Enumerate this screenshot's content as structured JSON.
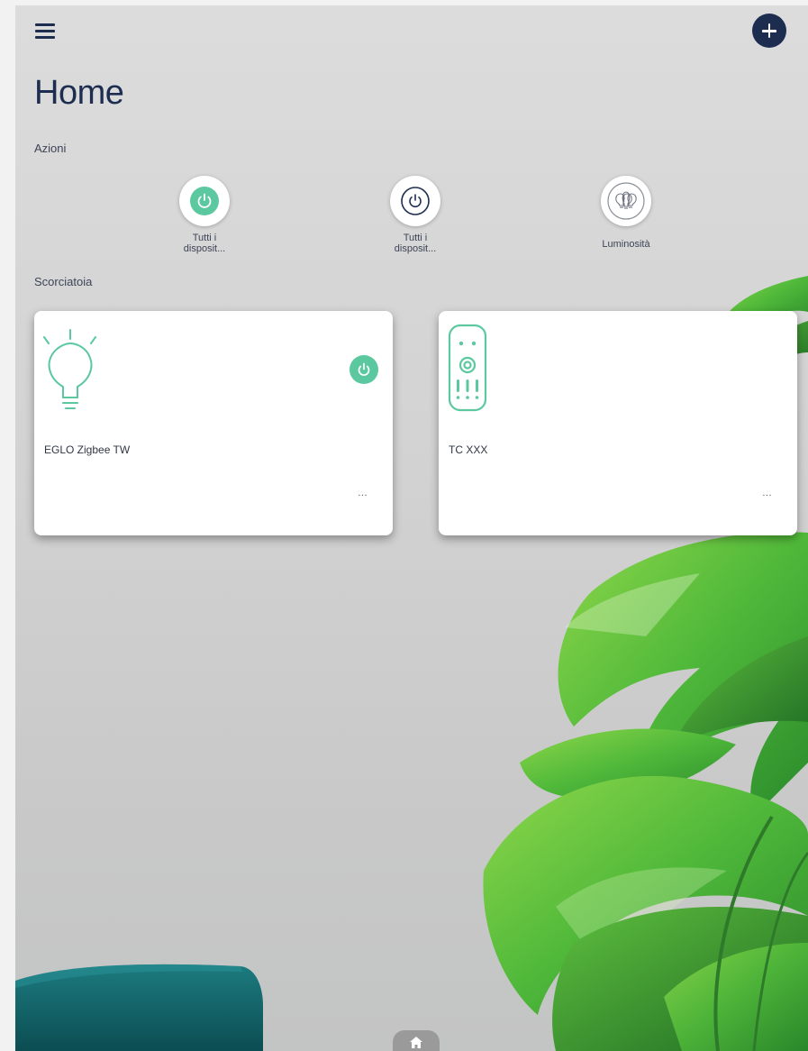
{
  "header": {
    "title": "Home",
    "menu_icon": "hamburger-menu-icon",
    "add_icon": "plus-icon"
  },
  "actions": {
    "section_label": "Azioni",
    "items": [
      {
        "label_line1": "Tutti i",
        "label_line2": "disposit...",
        "icon": "power-icon",
        "state": "on",
        "color": "#5bc8a0"
      },
      {
        "label_line1": "Tutti i",
        "label_line2": "disposit...",
        "icon": "power-icon",
        "state": "off",
        "color": "#1d2d50"
      },
      {
        "label_line1": "Luminosità",
        "label_line2": "",
        "icon": "light-bulbs-icon",
        "color": "#ffffff"
      }
    ]
  },
  "shortcuts": {
    "section_label": "Scorciatoia",
    "cards": [
      {
        "name": "EGLO Zigbee TW",
        "icon": "light-bulb-icon",
        "power": "on",
        "more_label": "..."
      },
      {
        "name": "TC XXX",
        "icon": "remote-control-icon",
        "more_label": "..."
      }
    ]
  },
  "bottom_nav": {
    "icon": "home-icon"
  },
  "colors": {
    "accent_green": "#5bc8a0",
    "navy": "#1d2d50",
    "card_bg": "#ffffff"
  }
}
